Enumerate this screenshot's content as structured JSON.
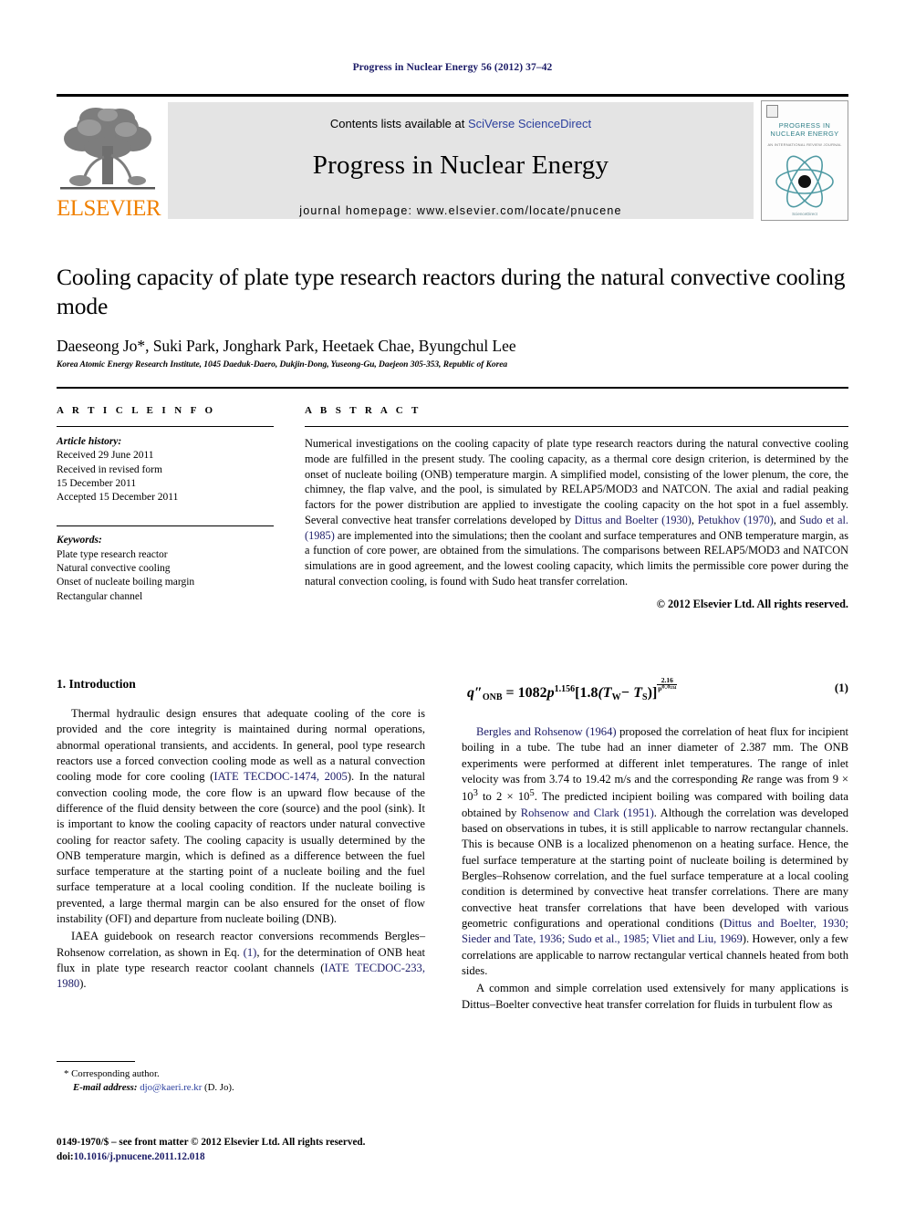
{
  "running_head": "Progress in Nuclear Energy 56 (2012) 37–42",
  "masthead": {
    "publisher_wordmark": "ELSEVIER",
    "contents_prefix": "Contents lists available at ",
    "contents_link": "SciVerse ScienceDirect",
    "journal_name": "Progress in Nuclear Energy",
    "homepage_prefix": "journal homepage: ",
    "homepage_url": "www.elsevier.com/locate/pnucene",
    "cover": {
      "title_line1": "PROGRESS IN",
      "title_line2": "NUCLEAR ENERGY",
      "subtitle": "AN INTERNATIONAL REVIEW JOURNAL",
      "footer": "ScienceDirect"
    }
  },
  "article": {
    "title": "Cooling capacity of plate type research reactors during the natural convective cooling mode",
    "authors": "Daeseong Jo*, Suki Park, Jonghark Park, Heetaek Chae, Byungchul Lee",
    "affiliation": "Korea Atomic Energy Research Institute, 1045 Daeduk-Daero, Dukjin-Dong, Yuseong-Gu, Daejeon 305-353, Republic of Korea"
  },
  "article_info": {
    "section_label": "A R T I C L E   I N F O",
    "history_label": "Article history:",
    "history": [
      "Received 29 June 2011",
      "Received in revised form",
      "15 December 2011",
      "Accepted 15 December 2011"
    ],
    "keywords_label": "Keywords:",
    "keywords": [
      "Plate type research reactor",
      "Natural convective cooling",
      "Onset of nucleate boiling margin",
      "Rectangular channel"
    ]
  },
  "abstract": {
    "section_label": "A B S T R A C T",
    "part1": "Numerical investigations on the cooling capacity of plate type research reactors during the natural convective cooling mode are fulfilled in the present study. The cooling capacity, as a thermal core design criterion, is determined by the onset of nucleate boiling (ONB) temperature margin. A simplified model, consisting of the lower plenum, the core, the chimney, the flap valve, and the pool, is simulated by RELAP5/MOD3 and NATCON. The axial and radial peaking factors for the power distribution are applied to investigate the cooling capacity on the hot spot in a fuel assembly. Several convective heat transfer correlations developed by ",
    "cite1": "Dittus and Boelter (1930)",
    "part2": ", ",
    "cite2": "Petukhov (1970)",
    "part3": ", and ",
    "cite3": "Sudo et al. (1985)",
    "part4": " are implemented into the simulations; then the coolant and surface temperatures and ONB temperature margin, as a function of core power, are obtained from the simulations. The comparisons between RELAP5/MOD3 and NATCON simulations are in good agreement, and the lowest cooling capacity, which limits the permissible core power during the natural convection cooling, is found with Sudo heat transfer correlation.",
    "copyright": "© 2012 Elsevier Ltd. All rights reserved."
  },
  "introduction": {
    "heading": "1.  Introduction",
    "p1_a": "Thermal hydraulic design ensures that adequate cooling of the core is provided and the core integrity is maintained during normal operations, abnormal operational transients, and accidents. In general, pool type research reactors use a forced convection cooling mode as well as a natural convection cooling mode for core cooling (",
    "p1_cite1": "IATE TECDOC-1474, 2005",
    "p1_b": "). In the natural convection cooling mode, the core flow is an upward flow because of the difference of the fluid density between the core (source) and the pool (sink). It is important to know the cooling capacity of reactors under natural convective cooling for reactor safety. The cooling capacity is usually determined by the ONB temperature margin, which is defined as a difference between the fuel surface temperature at the starting point of a nucleate boiling and the fuel surface temperature at a local cooling condition. If the nucleate boiling is prevented, a large thermal margin can be also ensured for the onset of flow instability (OFI) and departure from nucleate boiling (DNB).",
    "p2_a": "IAEA guidebook on research reactor conversions recommends Bergles–Rohsenow correlation, as shown in Eq. ",
    "p2_eqref": "(1)",
    "p2_b": ", for the determination of ONB heat flux in plate type research reactor coolant channels (",
    "p2_cite1": "IATE TECDOC-233, 1980",
    "p2_c": ")."
  },
  "equation_1": {
    "lhs": "q",
    "lhs_sub": "ONB",
    "lhs_prime": "″",
    "equals": "=",
    "coefficient": "1082",
    "p_symbol": "p",
    "p_exponent": "1.156",
    "bracket_open": "[",
    "factor": "1.8",
    "paren": "(T",
    "tw_sub": "W",
    "minus": "− T",
    "ts_sub": "S",
    "paren_close": ")",
    "bracket_close": "]",
    "exp_numerator": "2.16",
    "exp_denominator": "p⁰·⁰²³⁴",
    "number": "(1)",
    "plain": "q″_ONB = 1082p^1.156[1.8(T_W − T_S)]^(2.16/p^0.0234)"
  },
  "right_column": {
    "p1_cite1": "Bergles and Rohsenow (1964)",
    "p1_a": " proposed the correlation of heat flux for incipient boiling in a tube. The tube had an inner diameter of 2.387 mm. The ONB experiments were performed at different inlet temperatures. The range of inlet velocity was from 3.74 to 19.42 m/s and the corresponding ",
    "p1_re": "Re",
    "p1_b": " range was from 9 × 10",
    "p1_exp1": "3",
    "p1_c": " to 2 × 10",
    "p1_exp2": "5",
    "p1_d": ". The predicted incipient boiling was compared with boiling data obtained by ",
    "p1_cite2": "Rohsenow and Clark (1951)",
    "p1_e": ". Although the correlation was developed based on observations in tubes, it is still applicable to narrow rectangular channels. This is because ONB is a localized phenomenon on a heating surface. Hence, the fuel surface temperature at the starting point of nucleate boiling is determined by Bergles–Rohsenow correlation, and the fuel surface temperature at a local cooling condition is determined by convective heat transfer correlations. There are many convective heat transfer correlations that have been developed with various geometric configurations and operational conditions (",
    "p1_cite3": "Dittus and Boelter, 1930; Sieder and Tate, 1936; Sudo et al., 1985; Vliet and Liu, 1969",
    "p1_f": "). However, only a few correlations are applicable to narrow rectangular vertical channels heated from both sides.",
    "p2": "A common and simple correlation used extensively for many applications is Dittus–Boelter convective heat transfer correlation for fluids in turbulent flow as"
  },
  "footnotes": {
    "corresponding": "* Corresponding author.",
    "email_label": "E-mail address:",
    "email": "djo@kaeri.re.kr",
    "email_suffix": " (D. Jo)."
  },
  "colophon": {
    "line1": "0149-1970/$ – see front matter © 2012 Elsevier Ltd. All rights reserved.",
    "doi_label": "doi:",
    "doi": "10.1016/j.pnucene.2011.12.018"
  },
  "colors": {
    "link_blue": "#2b3f9e",
    "header_navy": "#1a1a66",
    "elsevier_orange": "#f08000",
    "masthead_gray": "#e4e4e4",
    "cover_teal": "#4f9aa3"
  }
}
